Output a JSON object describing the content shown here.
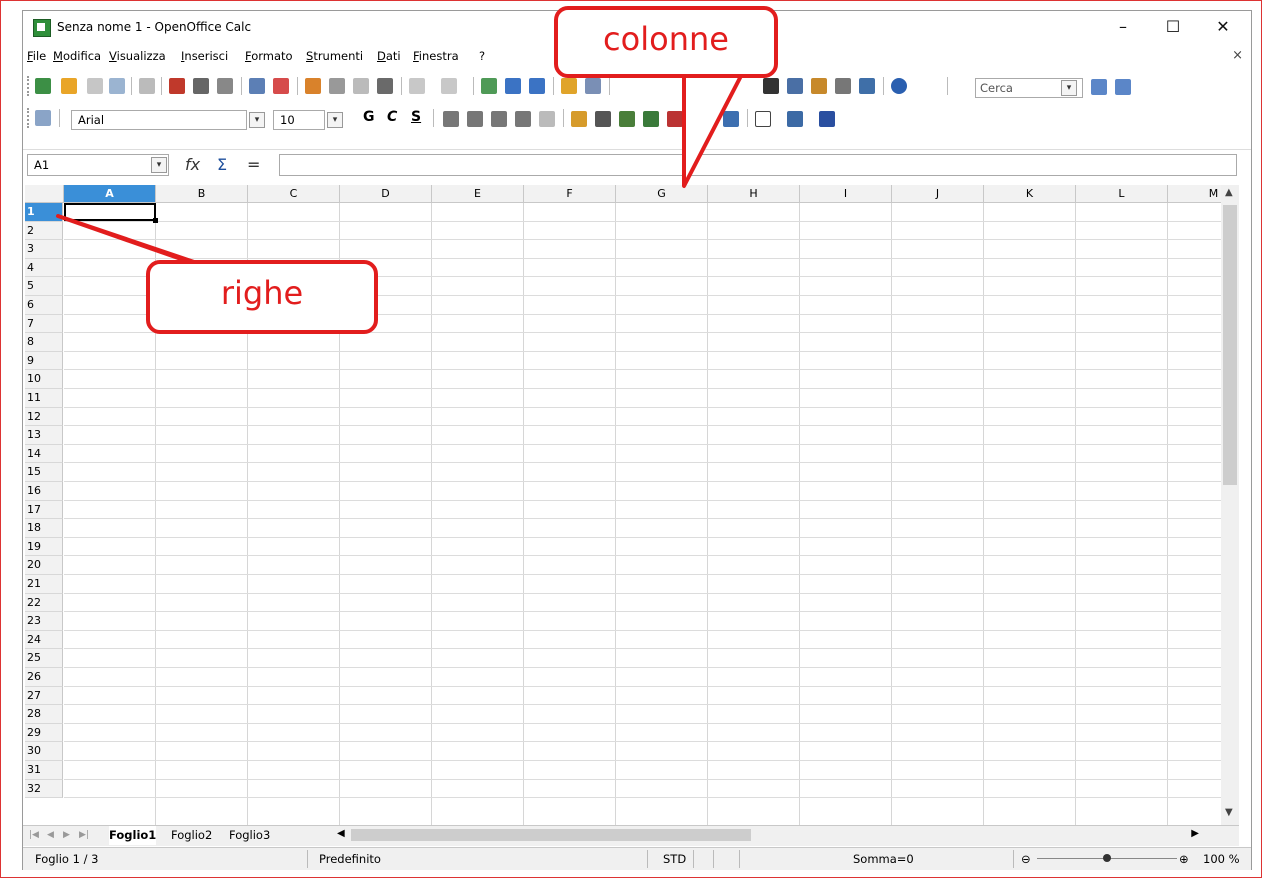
{
  "window": {
    "title": "Senza nome 1 - OpenOffice Calc",
    "minimize": "–",
    "maximize": "☐",
    "close": "✕"
  },
  "menu": {
    "items": [
      "File",
      "Modifica",
      "Visualizza",
      "Inserisci",
      "Formato",
      "Strumenti",
      "Dati",
      "Finestra",
      "?"
    ],
    "close_doc": "×"
  },
  "toolbar": {
    "search_placeholder": "Cerca",
    "font_name": "Arial",
    "font_size": "10",
    "bold": "G",
    "italic": "C",
    "underline": "S"
  },
  "formula_bar": {
    "cell_ref": "A1",
    "fx_icon": "fx",
    "sum_icon": "Σ",
    "equals": "=",
    "content": ""
  },
  "grid": {
    "columns": [
      "A",
      "B",
      "C",
      "D",
      "E",
      "F",
      "G",
      "H",
      "I",
      "J",
      "K",
      "L",
      "M"
    ],
    "rows": [
      "1",
      "2",
      "3",
      "4",
      "5",
      "6",
      "7",
      "8",
      "9",
      "10",
      "11",
      "12",
      "13",
      "14",
      "15",
      "16",
      "17",
      "18",
      "19",
      "20",
      "21",
      "22",
      "23",
      "24",
      "25",
      "26",
      "27",
      "28",
      "29",
      "30",
      "31",
      "32"
    ],
    "selected_column": "A",
    "selected_row": "1"
  },
  "sheets": {
    "tabs": [
      "Foglio1",
      "Foglio2",
      "Foglio3"
    ],
    "active": "Foglio1"
  },
  "status": {
    "sheet_pos": "Foglio 1 / 3",
    "page_style": "Predefinito",
    "mode": "STD",
    "sum": "Somma=0",
    "zoom": "100 %",
    "zoom_minus": "⊖",
    "zoom_plus": "⊕"
  },
  "annotations": {
    "columns_label": "colonne",
    "rows_label": "righe",
    "color": "#e21d1d"
  }
}
